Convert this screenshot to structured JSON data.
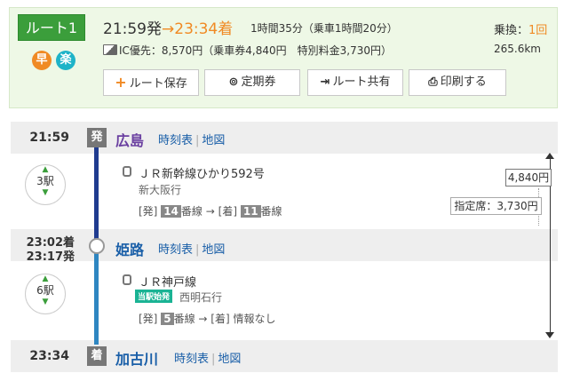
{
  "header": {
    "route_label": "ルート1",
    "badge_fast": "早",
    "badge_easy": "楽",
    "depart_time": "21:59発",
    "arrow": "→",
    "arrive_time": "23:34着",
    "duration": "1時間35分（乗車1時間20分）",
    "transfer_label": "乗換：",
    "transfer_count": "1回",
    "fare_text": "IC優先：8,570円（乗車券4,840円　特別料金3,730円）",
    "distance": "265.6km",
    "buttons": {
      "save": "ルート保存",
      "pass": "定期券",
      "share": "ルート共有",
      "print": "印刷する"
    }
  },
  "stations": [
    {
      "time": "21:59",
      "tag": "発",
      "name": "広島",
      "name_color": "#6a3fa0",
      "timetable": "時刻表",
      "map": "地図"
    },
    {
      "time_arr": "23:02着",
      "time_dep": "23:17発",
      "name": "姫路",
      "name_color": "#1a5fa8",
      "timetable": "時刻表",
      "map": "地図"
    },
    {
      "time": "23:34",
      "tag": "着",
      "name": "加古川",
      "name_color": "#1a5fa8",
      "timetable": "時刻表",
      "map": "地図"
    }
  ],
  "segments": [
    {
      "stops": "3駅",
      "train": "ＪＲ新幹線ひかり592号",
      "dest": "新大阪行",
      "plat_dep_label": "[発]",
      "plat_dep": "14",
      "plat_unit": "番線",
      "arrow": "→",
      "plat_arr_label": "[着]",
      "plat_arr": "11",
      "plat_arr_unit": "番線"
    },
    {
      "stops": "6駅",
      "train": "ＪＲ神戸線",
      "first_badge": "当駅始発",
      "dest": "西明石行",
      "plat_dep_label": "[発]",
      "plat_dep": "5",
      "plat_unit": "番線",
      "arrow": "→",
      "plat_arr_label": "[着]",
      "plat_arr_text": "情報なし"
    }
  ],
  "fare_box": "4,840円",
  "reserved_box": "指定席：3,730円",
  "colors": {
    "accent_green": "#3b9e3b",
    "orange": "#f08a24",
    "shinkansen_line": "#1f3b8f",
    "kobe_line": "#2e86c1"
  }
}
